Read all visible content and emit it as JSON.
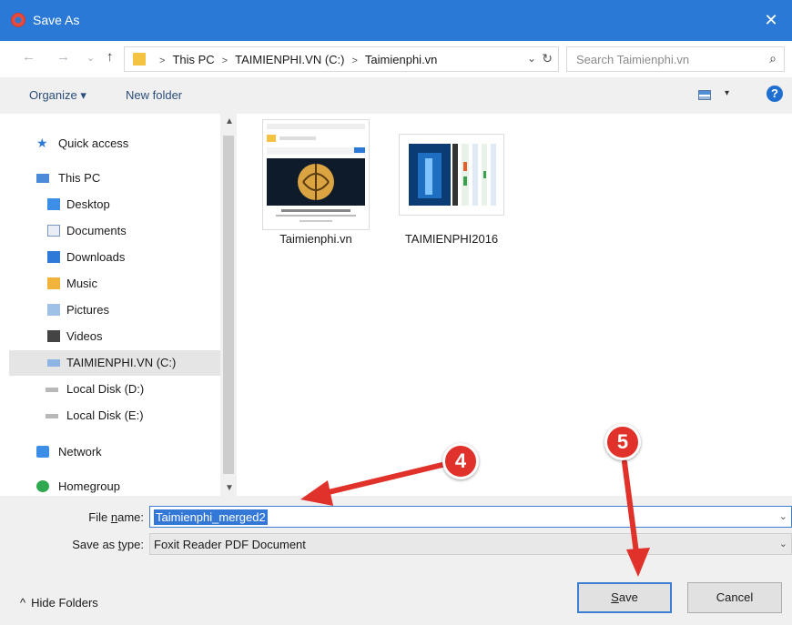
{
  "window": {
    "title": "Save As",
    "close_glyph": "✕"
  },
  "nav": {
    "back": "←",
    "forward": "→",
    "recent": "⌄",
    "up": "↑",
    "breadcrumbs": [
      "This PC",
      "TAIMIENPHI.VN (C:)",
      "Taimienphi.vn"
    ],
    "address_dropdown": "⌄",
    "refresh": "↻",
    "search_placeholder": "Search Taimienphi.vn",
    "search_icon": "⌕"
  },
  "toolbar": {
    "organize": "Organize ▾",
    "new_folder": "New folder",
    "view_dropdown": "▾",
    "help": "?"
  },
  "sidebar": {
    "items": [
      {
        "label": "Quick access",
        "icon": "star-icon"
      },
      {
        "label": "This PC",
        "icon": "computer-icon"
      },
      {
        "label": "Desktop",
        "icon": "desktop-folder-icon"
      },
      {
        "label": "Documents",
        "icon": "documents-folder-icon"
      },
      {
        "label": "Downloads",
        "icon": "downloads-folder-icon"
      },
      {
        "label": "Music",
        "icon": "music-folder-icon"
      },
      {
        "label": "Pictures",
        "icon": "pictures-folder-icon"
      },
      {
        "label": "Videos",
        "icon": "videos-folder-icon"
      },
      {
        "label": "TAIMIENPHI.VN (C:)",
        "icon": "drive-c-icon",
        "selected": true
      },
      {
        "label": "Local Disk (D:)",
        "icon": "disk-icon"
      },
      {
        "label": "Local Disk (E:)",
        "icon": "disk-icon"
      },
      {
        "label": "Network",
        "icon": "network-icon"
      },
      {
        "label": "Homegroup",
        "icon": "homegroup-icon"
      }
    ]
  },
  "files": [
    {
      "name": "Taimienphi.vn",
      "thumb_text": "Tạo Menu, Tiết kiệm"
    },
    {
      "name": "TAIMIENPHI2016"
    }
  ],
  "form": {
    "file_name_label_pre": "File ",
    "file_name_label_u": "n",
    "file_name_label_post": "ame:",
    "file_name_value": "Taimienphi_merged2",
    "save_type_label_pre": "Save as ",
    "save_type_label_u": "t",
    "save_type_label_post": "ype:",
    "save_type_value": "Foxit Reader PDF Document",
    "dropdown_glyph": "⌄"
  },
  "footer": {
    "hide_folders": "Hide Folders",
    "hide_folders_glyph": "^",
    "save_u": "S",
    "save_rest": "ave",
    "cancel": "Cancel"
  },
  "annotations": [
    {
      "number": "4",
      "color": "#e0312a"
    },
    {
      "number": "5",
      "color": "#e0312a"
    }
  ],
  "colors": {
    "titlebar": "#2b79d6",
    "selection": "#3378d6",
    "annotation": "#e0312a"
  }
}
